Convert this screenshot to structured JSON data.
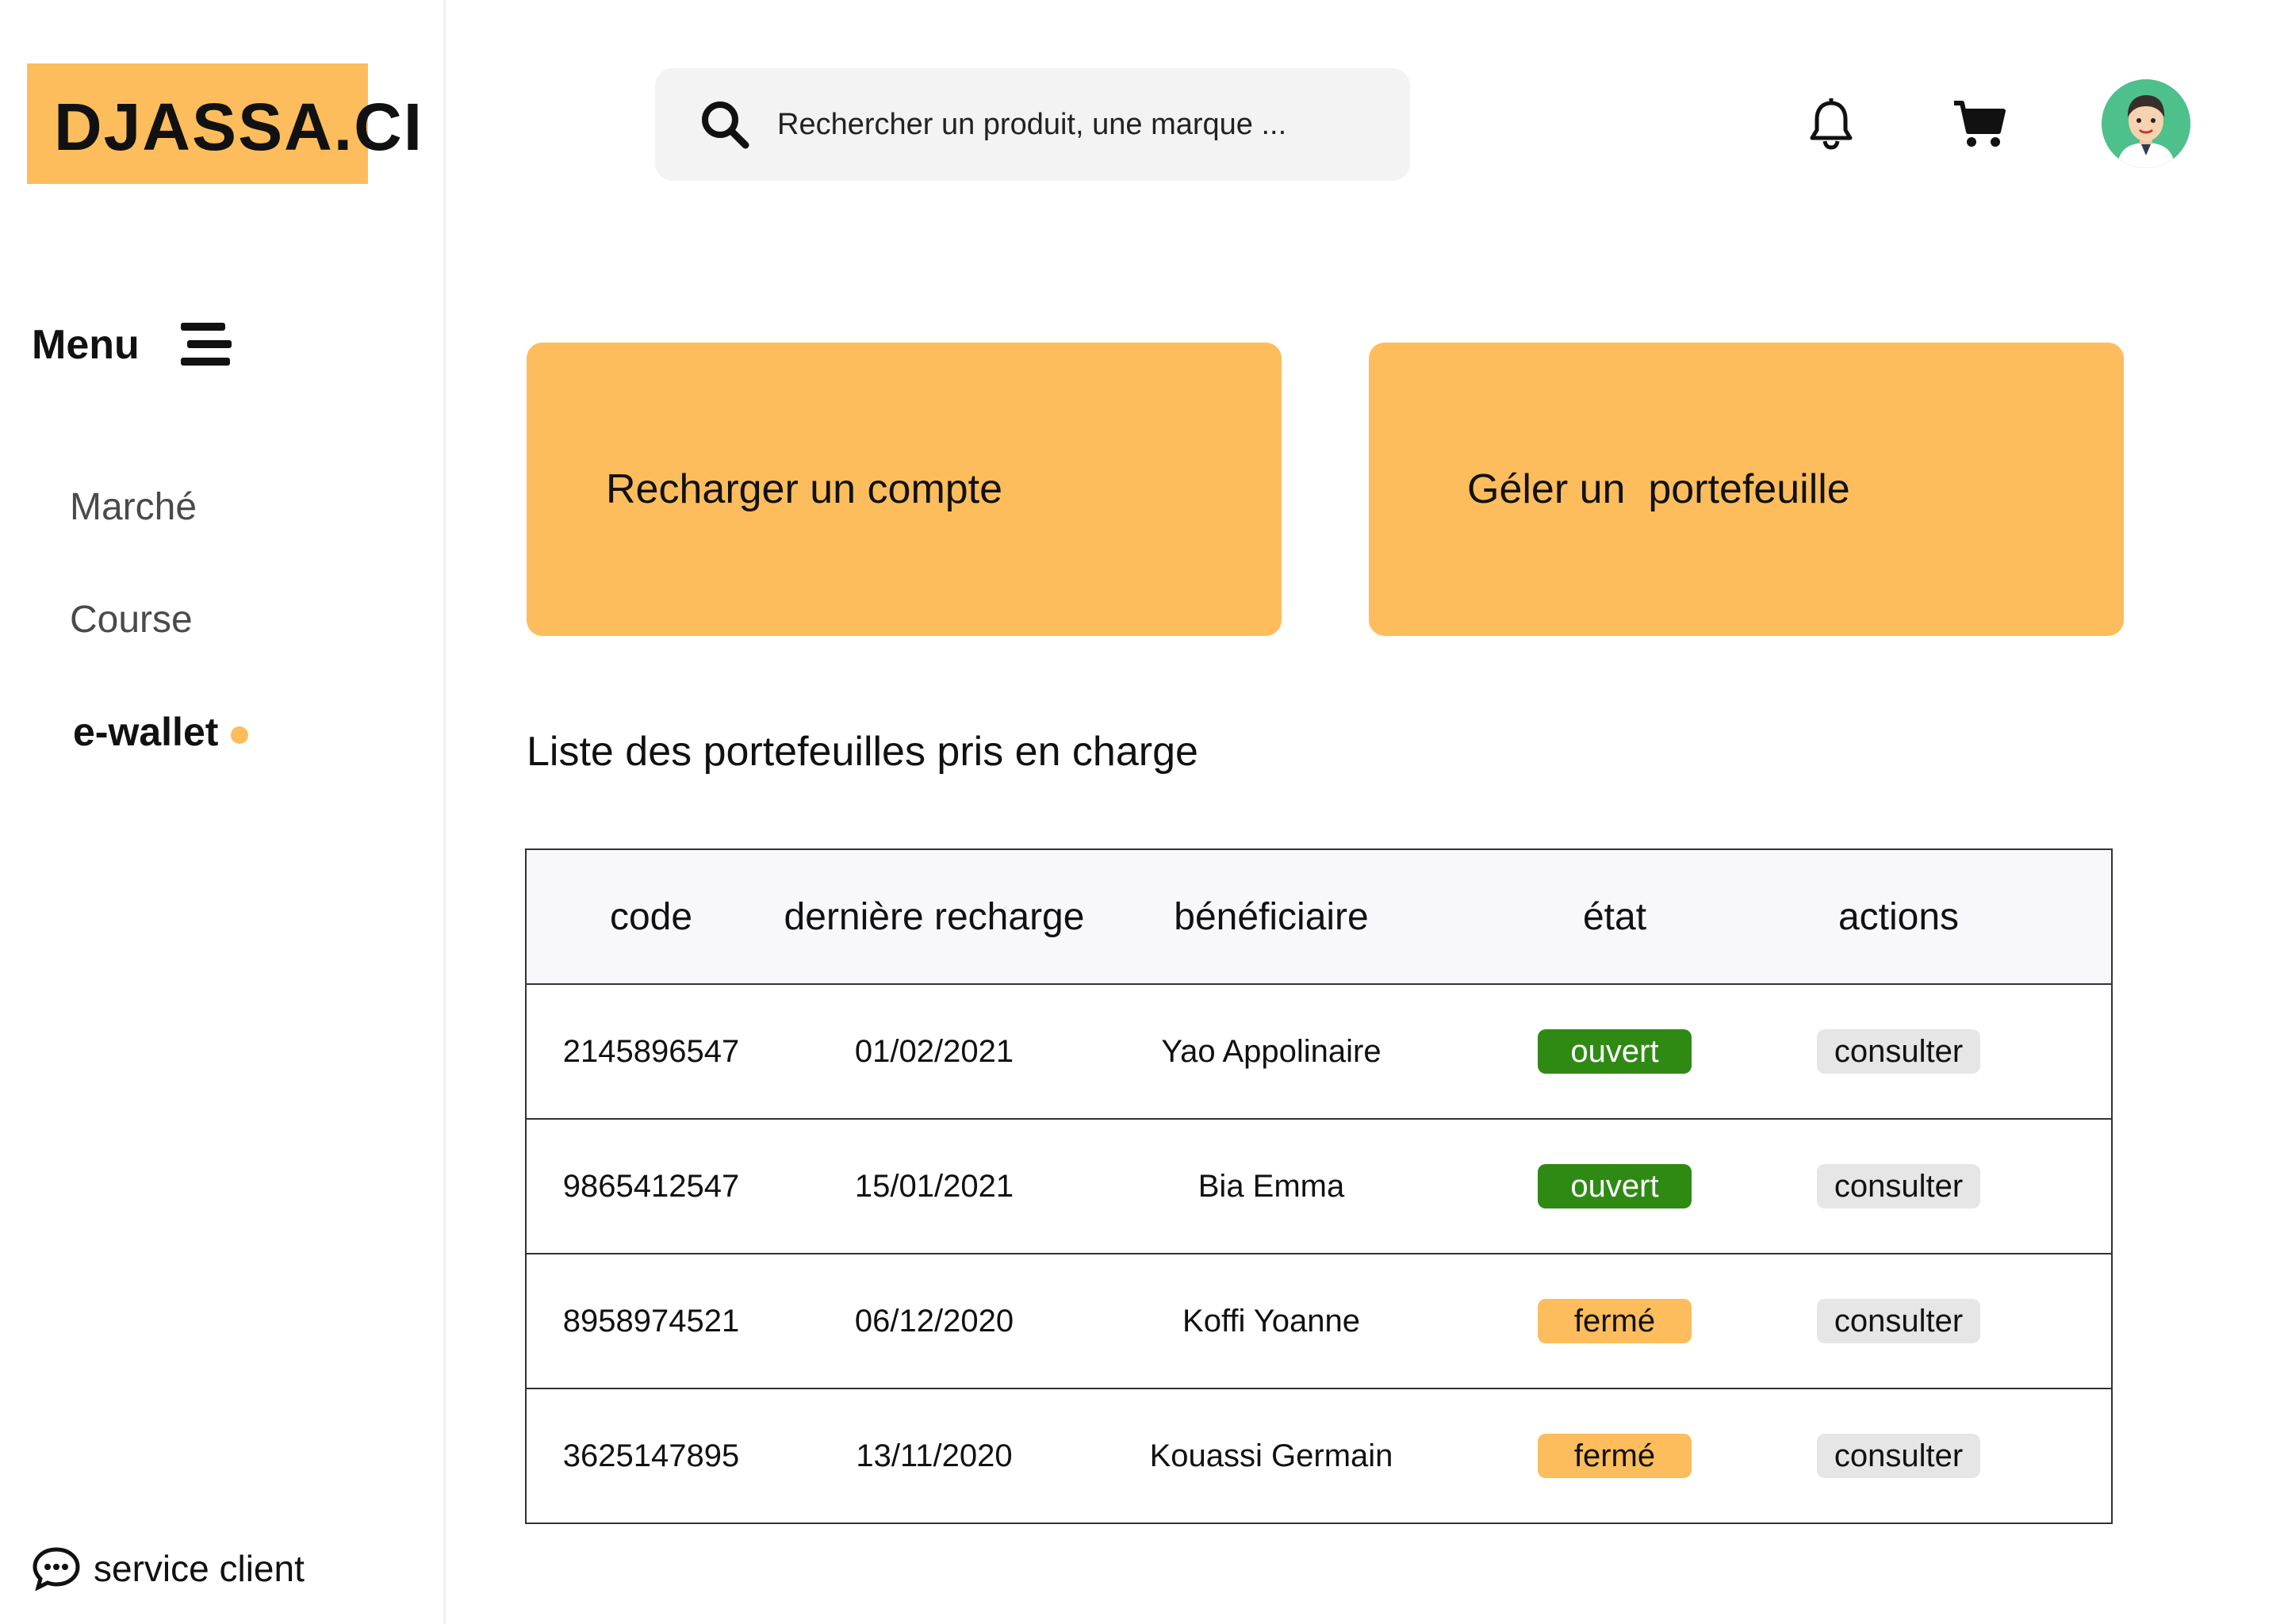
{
  "brand": {
    "logo_text": "DJASSA.CI",
    "accent_color": "#fdbd5c"
  },
  "sidebar": {
    "menu_label": "Menu",
    "menu_icon": "hamburger-icon",
    "items": [
      {
        "label": "Marché",
        "active": false
      },
      {
        "label": "Course",
        "active": false
      },
      {
        "label": "e-wallet",
        "active": true
      }
    ],
    "service_client": {
      "label": "service client",
      "icon": "chat-bubble-icon"
    }
  },
  "header": {
    "search": {
      "placeholder": "Rechercher un produit, une marque ...",
      "icon": "search-icon"
    },
    "icons": [
      "bell-icon",
      "cart-icon",
      "avatar"
    ]
  },
  "actions": [
    {
      "label": "Recharger un compte"
    },
    {
      "label": "Géler un  portefeuille"
    }
  ],
  "section_title": "Liste des portefeuilles pris en charge",
  "table": {
    "columns": [
      "code",
      "dernière recharge",
      "bénéficiaire",
      "état",
      "actions"
    ],
    "rows": [
      {
        "code": "2145896547",
        "date": "01/02/2021",
        "beneficiary": "Yao Appolinaire",
        "state": "ouvert",
        "state_type": "open",
        "action": "consulter"
      },
      {
        "code": "9865412547",
        "date": "15/01/2021",
        "beneficiary": "Bia Emma",
        "state": "ouvert",
        "state_type": "open",
        "action": "consulter"
      },
      {
        "code": "8958974521",
        "date": "06/12/2020",
        "beneficiary": "Koffi Yoanne",
        "state": "fermé",
        "state_type": "closed",
        "action": "consulter"
      },
      {
        "code": "3625147895",
        "date": "13/11/2020",
        "beneficiary": "Kouassi Germain",
        "state": "fermé",
        "state_type": "closed",
        "action": "consulter"
      }
    ],
    "status_colors": {
      "open": "#2f8a14",
      "closed": "#fdbd5c"
    }
  }
}
